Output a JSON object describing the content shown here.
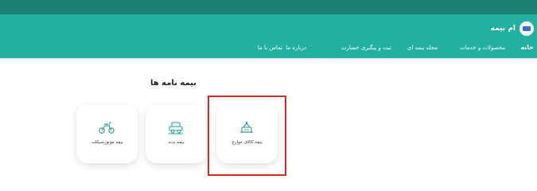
{
  "brand": {
    "name": "ام بیمه",
    "logo": "brand-logo"
  },
  "nav": {
    "home": "خانه",
    "products": "محصولات و خدمات",
    "magazine": "مجله بیمه ای",
    "claims": "ثبت و پیگیری خسارت",
    "about": "درباره ما",
    "contact": "تماس با ما"
  },
  "section": {
    "title": "بیمه نامه ها"
  },
  "cards": [
    {
      "label": "بیمه کالای خوارج",
      "icon": "travel-icon"
    },
    {
      "label": "بیمه بدنه",
      "icon": "car-body-icon"
    },
    {
      "label": "بیمه موتورسیکلت",
      "icon": "motorcycle-icon"
    }
  ],
  "colors": {
    "topbar": "#1b7f72",
    "navbar": "#23b0a0",
    "accent": "#2a9d8f",
    "highlight": "#d22a2a"
  }
}
